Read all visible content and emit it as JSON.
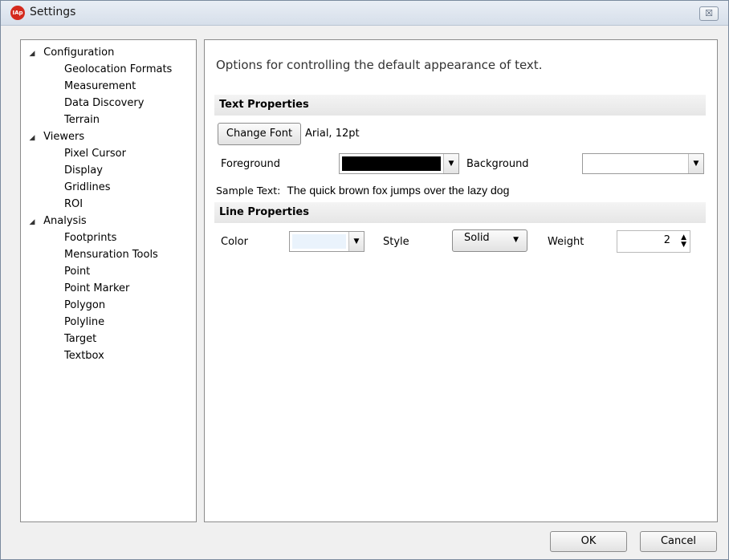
{
  "window": {
    "title": "Settings",
    "app_icon_text": "IAp",
    "close_glyph": "☒"
  },
  "tree": {
    "categories": [
      {
        "label": "Configuration",
        "children": [
          "Geolocation Formats",
          "Measurement",
          "Data Discovery",
          "Terrain"
        ]
      },
      {
        "label": "Viewers",
        "children": [
          "Pixel Cursor",
          "Display",
          "Gridlines",
          "ROI"
        ]
      },
      {
        "label": "Analysis",
        "children": [
          "Footprints",
          "Mensuration Tools",
          "Point",
          "Point Marker",
          "Polygon",
          "Polyline",
          "Target",
          "Textbox"
        ]
      }
    ],
    "selected": "Textbox",
    "expand_glyph": "◢"
  },
  "panel": {
    "description": "Options for controlling the default appearance of text.",
    "text_properties": {
      "header": "Text Properties",
      "change_font_label": "Change Font",
      "font_value": "Arial, 12pt",
      "foreground_label": "Foreground",
      "foreground_color": "#000000",
      "background_label": "Background",
      "background_color": "#ffffff",
      "sample_label": "Sample Text:",
      "sample_text": "The quick brown fox jumps over the lazy dog"
    },
    "line_properties": {
      "header": "Line Properties",
      "color_label": "Color",
      "color_value": "#eaf3fc",
      "style_label": "Style",
      "style_value": "Solid",
      "weight_label": "Weight",
      "weight_value": "2"
    }
  },
  "footer": {
    "ok_label": "OK",
    "cancel_label": "Cancel"
  }
}
